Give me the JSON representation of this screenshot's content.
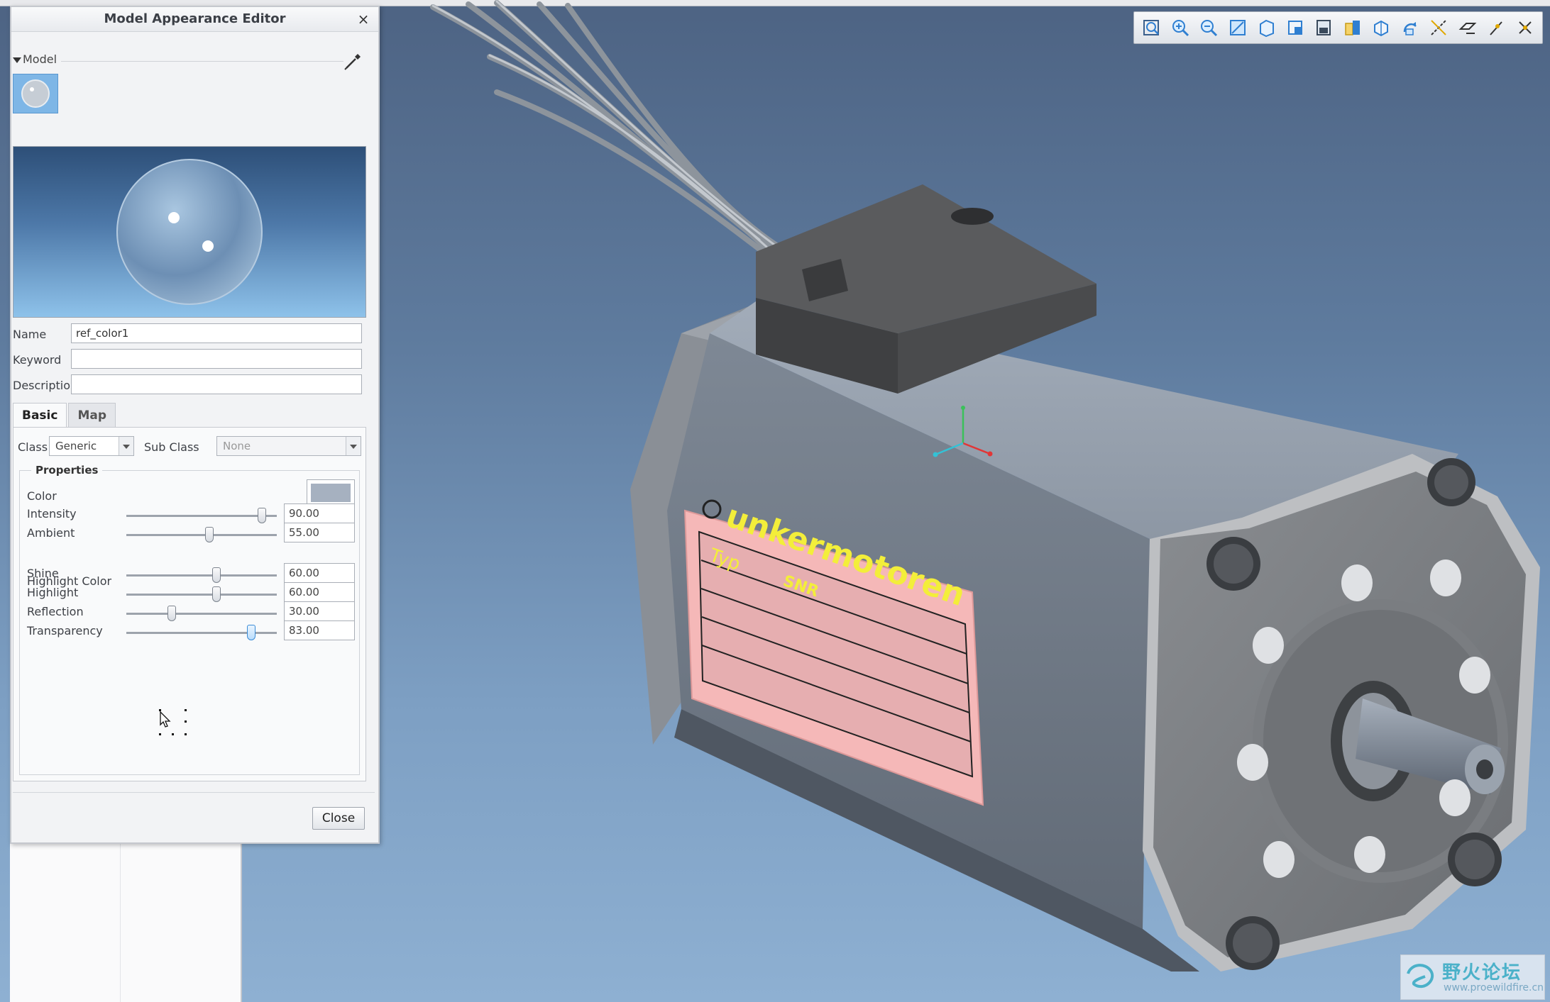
{
  "dialog": {
    "title": "Model Appearance Editor",
    "close_glyph": "×",
    "model_section": "Model",
    "fields": {
      "name_label": "Name",
      "name_value": "ref_color1",
      "keyword_label": "Keyword",
      "keyword_value": "",
      "description_label": "Description",
      "description_value": ""
    },
    "tabs": [
      "Basic",
      "Map"
    ],
    "class_label": "Class",
    "class_value": "Generic",
    "subclass_label": "Sub Class",
    "subclass_value": "None",
    "properties_legend": "Properties",
    "color_label": "Color",
    "color_value": "#a6b1c0",
    "highlight_color_label": "Highlight Color",
    "highlight_color_value": "#ffffff",
    "sliders": [
      {
        "label": "Intensity",
        "value": "90.00",
        "level": 0.9
      },
      {
        "label": "Ambient",
        "value": "55.00",
        "level": 0.55
      },
      {
        "label": "Shine",
        "value": "60.00",
        "level": 0.6
      },
      {
        "label": "Highlight",
        "value": "60.00",
        "level": 0.6
      },
      {
        "label": "Reflection",
        "value": "30.00",
        "level": 0.3
      },
      {
        "label": "Transparency",
        "value": "83.00",
        "level": 0.83
      }
    ],
    "close_button": "Close"
  },
  "toolbar": {
    "icons": [
      "refit-icon",
      "zoom-in-icon",
      "zoom-out-icon",
      "repaint-icon",
      "named-views-icon",
      "view-manager-icon",
      "display-style-icon",
      "perspective-icon",
      "orient-icon",
      "spin-center-icon",
      "datum-axis-icon",
      "datum-plane-icon",
      "datum-point-icon",
      "coordinate-system-icon"
    ]
  },
  "model_label": {
    "brand": "unkermotoren",
    "typ": "Typ",
    "snr": "SNR"
  },
  "watermark": {
    "title": "野火论坛",
    "url": "www.proewildfire.cn"
  },
  "colors": {
    "viewport_top": "#4d6383",
    "viewport_bottom": "#8eb0d2",
    "motor_body": "#808a96",
    "label_pink": "#f5b8b8",
    "label_text": "#f3ee3a"
  }
}
